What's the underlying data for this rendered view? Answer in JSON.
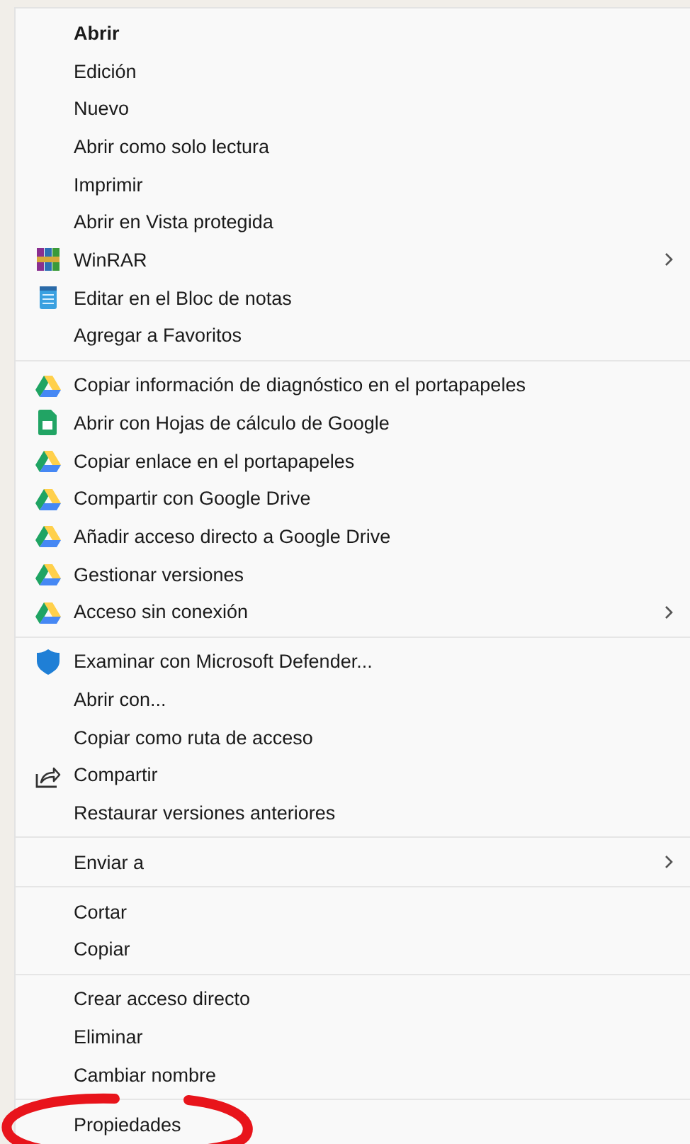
{
  "context_menu": {
    "groups": [
      {
        "items": [
          {
            "label": "Abrir",
            "kind": "plain",
            "default": true,
            "submenu": false
          },
          {
            "label": "Edición",
            "kind": "plain",
            "default": false,
            "submenu": false
          },
          {
            "label": "Nuevo",
            "kind": "plain",
            "default": false,
            "submenu": false
          },
          {
            "label": "Abrir como solo lectura",
            "kind": "plain",
            "default": false,
            "submenu": false
          },
          {
            "label": "Imprimir",
            "kind": "plain",
            "default": false,
            "submenu": false
          },
          {
            "label": "Abrir en Vista protegida",
            "kind": "plain",
            "default": false,
            "submenu": false
          },
          {
            "label": "WinRAR",
            "kind": "winrar",
            "default": false,
            "submenu": true
          },
          {
            "label": "Editar en el Bloc de notas",
            "kind": "notepad",
            "default": false,
            "submenu": false
          },
          {
            "label": "Agregar a Favoritos",
            "kind": "plain",
            "default": false,
            "submenu": false
          }
        ]
      },
      {
        "items": [
          {
            "label": "Copiar información de diagnóstico en el portapapeles",
            "kind": "drive",
            "default": false,
            "submenu": false
          },
          {
            "label": "Abrir con Hojas de cálculo de Google",
            "kind": "sheets",
            "default": false,
            "submenu": false
          },
          {
            "label": "Copiar enlace en el portapapeles",
            "kind": "drive",
            "default": false,
            "submenu": false
          },
          {
            "label": "Compartir con Google Drive",
            "kind": "drive",
            "default": false,
            "submenu": false
          },
          {
            "label": "Añadir acceso directo a Google Drive",
            "kind": "drive",
            "default": false,
            "submenu": false
          },
          {
            "label": "Gestionar versiones",
            "kind": "drive",
            "default": false,
            "submenu": false
          },
          {
            "label": "Acceso sin conexión",
            "kind": "drive",
            "default": false,
            "submenu": true
          }
        ]
      },
      {
        "items": [
          {
            "label": "Examinar con Microsoft Defender...",
            "kind": "defender",
            "default": false,
            "submenu": false
          },
          {
            "label": "Abrir con...",
            "kind": "plain",
            "default": false,
            "submenu": false
          },
          {
            "label": "Copiar como ruta de acceso",
            "kind": "plain",
            "default": false,
            "submenu": false
          },
          {
            "label": "Compartir",
            "kind": "share",
            "default": false,
            "submenu": false
          },
          {
            "label": "Restaurar versiones anteriores",
            "kind": "plain",
            "default": false,
            "submenu": false
          }
        ]
      },
      {
        "items": [
          {
            "label": "Enviar a",
            "kind": "plain",
            "default": false,
            "submenu": true
          }
        ]
      },
      {
        "items": [
          {
            "label": "Cortar",
            "kind": "plain",
            "default": false,
            "submenu": false
          },
          {
            "label": "Copiar",
            "kind": "plain",
            "default": false,
            "submenu": false
          }
        ]
      },
      {
        "items": [
          {
            "label": "Crear acceso directo",
            "kind": "plain",
            "default": false,
            "submenu": false
          },
          {
            "label": "Eliminar",
            "kind": "plain",
            "default": false,
            "submenu": false
          },
          {
            "label": "Cambiar nombre",
            "kind": "plain",
            "default": false,
            "submenu": false
          }
        ]
      },
      {
        "items": [
          {
            "label": "Propiedades",
            "kind": "plain",
            "default": false,
            "submenu": false,
            "circled": true
          }
        ]
      }
    ]
  }
}
